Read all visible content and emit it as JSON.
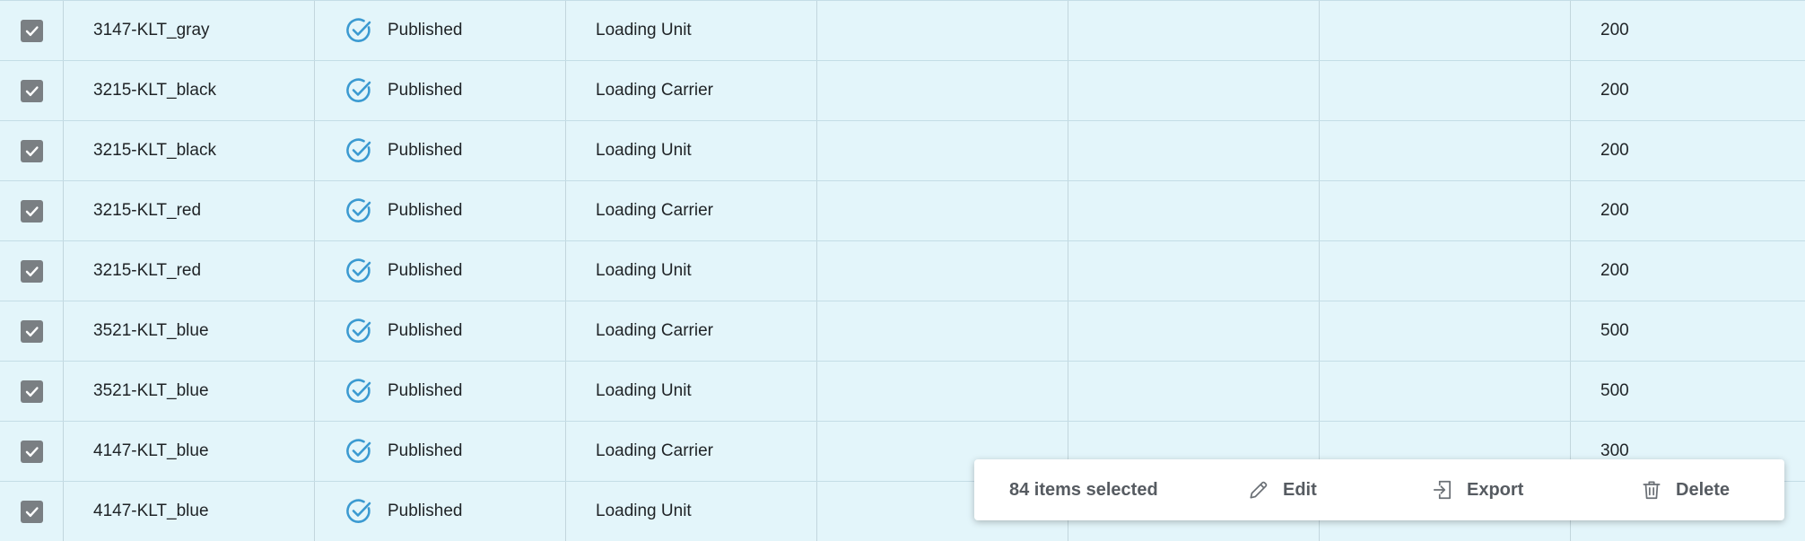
{
  "rows": [
    {
      "name": "3147-KLT_gray",
      "status": "Published",
      "type": "Loading Unit",
      "quantity": "200",
      "checked": true
    },
    {
      "name": "3215-KLT_black",
      "status": "Published",
      "type": "Loading Carrier",
      "quantity": "200",
      "checked": true
    },
    {
      "name": "3215-KLT_black",
      "status": "Published",
      "type": "Loading Unit",
      "quantity": "200",
      "checked": true
    },
    {
      "name": "3215-KLT_red",
      "status": "Published",
      "type": "Loading Carrier",
      "quantity": "200",
      "checked": true
    },
    {
      "name": "3215-KLT_red",
      "status": "Published",
      "type": "Loading Unit",
      "quantity": "200",
      "checked": true
    },
    {
      "name": "3521-KLT_blue",
      "status": "Published",
      "type": "Loading Carrier",
      "quantity": "500",
      "checked": true
    },
    {
      "name": "3521-KLT_blue",
      "status": "Published",
      "type": "Loading Unit",
      "quantity": "500",
      "checked": true
    },
    {
      "name": "4147-KLT_blue",
      "status": "Published",
      "type": "Loading Carrier",
      "quantity": "300",
      "checked": true
    },
    {
      "name": "4147-KLT_blue",
      "status": "Published",
      "type": "Loading Unit",
      "quantity": "",
      "checked": true
    }
  ],
  "action_bar": {
    "selected_text": "84 items selected",
    "edit_label": "Edit",
    "export_label": "Export",
    "delete_label": "Delete"
  },
  "icons": {
    "checkbox": "checkbox-checked-icon",
    "status": "check-circle-icon",
    "edit": "pencil-icon",
    "export": "export-icon",
    "delete": "trash-icon"
  },
  "colors": {
    "row_background": "#e3f5fa",
    "status_icon": "#3b9ad1",
    "checkbox": "#7a7f83",
    "action_text": "#565b61"
  }
}
